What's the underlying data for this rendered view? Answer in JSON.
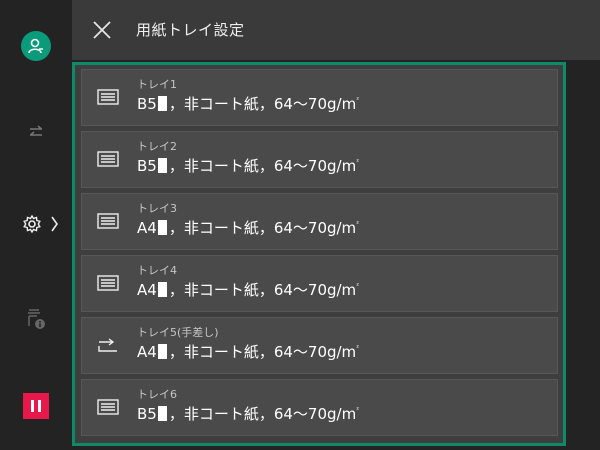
{
  "header": {
    "title": "用紙トレイ設定"
  },
  "trays": [
    {
      "name": "トレイ1",
      "size": "B5",
      "spec": "，非コート紙，64〜70g/m",
      "sup": "²",
      "icon": "tray-icon"
    },
    {
      "name": "トレイ2",
      "size": "B5",
      "spec": "，非コート紙，64〜70g/m",
      "sup": "²",
      "icon": "tray-icon"
    },
    {
      "name": "トレイ3",
      "size": "A4",
      "spec": "，非コート紙，64〜70g/m",
      "sup": "²",
      "icon": "tray-icon"
    },
    {
      "name": "トレイ4",
      "size": "A4",
      "spec": "，非コート紙，64〜70g/m",
      "sup": "²",
      "icon": "tray-icon"
    },
    {
      "name": "トレイ5(手差し)",
      "size": "A4",
      "spec": "，非コート紙，64〜70g/m",
      "sup": "²",
      "icon": "bypass-tray-icon"
    },
    {
      "name": "トレイ6",
      "size": "B5",
      "spec": "，非コート紙，64〜70g/m",
      "sup": "²",
      "icon": "tray-icon"
    }
  ],
  "colors": {
    "accent": "#0f8a66",
    "user_icon_bg": "#0a9b7a",
    "stop_button": "#e8194a"
  }
}
